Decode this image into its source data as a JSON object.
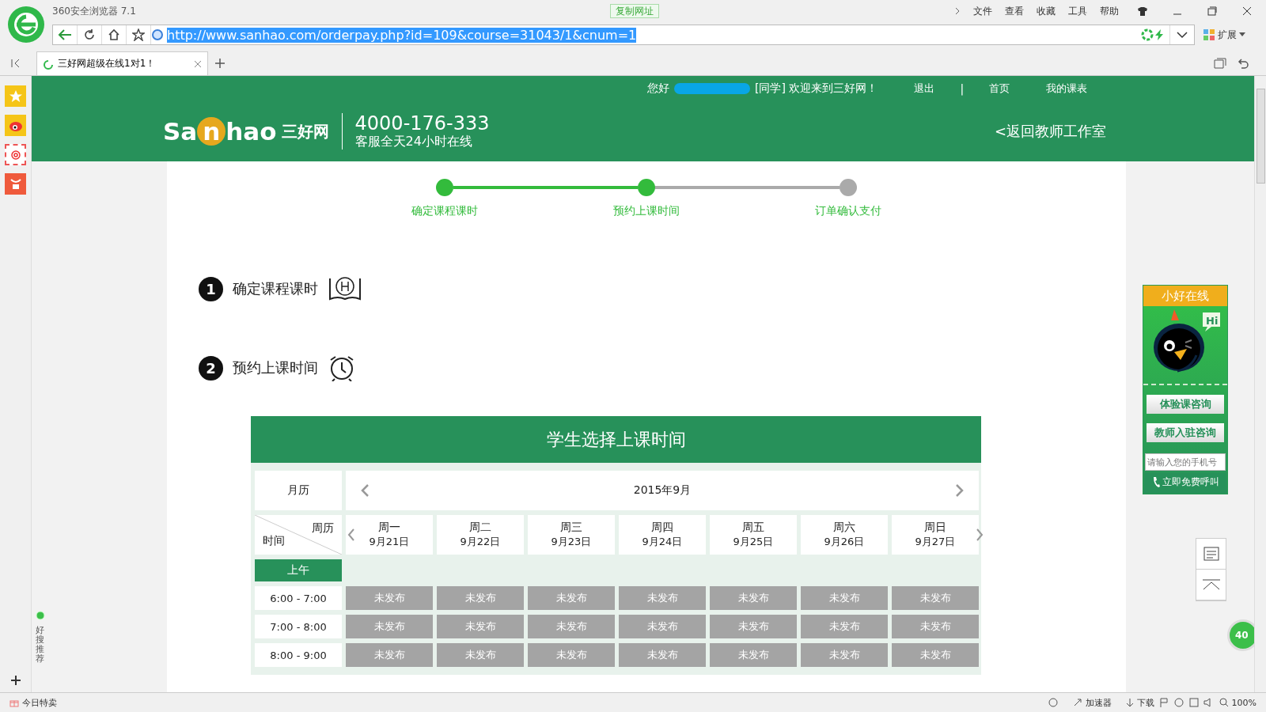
{
  "browser": {
    "title": "360安全浏览器 7.1",
    "copy_url": "复制网址",
    "menu": [
      "文件",
      "查看",
      "收藏",
      "工具",
      "帮助"
    ],
    "url": "http://www.sanhao.com/orderpay.php?id=109&course=31043/1&cnum=1",
    "extension": "扩展",
    "tab": {
      "title": "三好网超级在线1对1！",
      "selected": true
    },
    "side_recommend": "好搜推荐"
  },
  "header": {
    "greeting": "您好",
    "welcome": "[同学] 欢迎来到三好网！",
    "links": [
      "退出",
      "首页",
      "我的课表"
    ],
    "separator": "|",
    "logo": [
      "Sa",
      "n",
      "hao",
      "三好网"
    ],
    "phone": "4000-176-333",
    "service": "客服全天24小时在线",
    "back": "<返回教师工作室"
  },
  "steps": [
    {
      "label": "确定课程课时",
      "done": true
    },
    {
      "label": "预约上课时间",
      "done": true
    },
    {
      "label": "订单确认支付",
      "done": false
    }
  ],
  "sections": [
    {
      "number": "1",
      "title": "确定课程课时",
      "kind": "book"
    },
    {
      "number": "2",
      "title": "预约上课时间",
      "kind": "clock"
    }
  ],
  "calendar": {
    "title": "学生选择上课时间",
    "month_label": "月历",
    "month": "2015年9月",
    "corner_top": "周历",
    "corner_bottom": "时间",
    "period": "上午",
    "days": [
      {
        "weekday": "周一",
        "date": "9月21日"
      },
      {
        "weekday": "周二",
        "date": "9月22日"
      },
      {
        "weekday": "周三",
        "date": "9月23日"
      },
      {
        "weekday": "周四",
        "date": "9月24日"
      },
      {
        "weekday": "周五",
        "date": "9月25日"
      },
      {
        "weekday": "周六",
        "date": "9月26日"
      },
      {
        "weekday": "周日",
        "date": "9月27日"
      }
    ],
    "rows": [
      {
        "time": "6:00 - 7:00",
        "slots": [
          "未发布",
          "未发布",
          "未发布",
          "未发布",
          "未发布",
          "未发布",
          "未发布"
        ]
      },
      {
        "time": "7:00 - 8:00",
        "slots": [
          "未发布",
          "未发布",
          "未发布",
          "未发布",
          "未发布",
          "未发布",
          "未发布"
        ]
      },
      {
        "time": "8:00 - 9:00",
        "slots": [
          "未发布",
          "未发布",
          "未发布",
          "未发布",
          "未发布",
          "未发布",
          "未发布"
        ]
      }
    ]
  },
  "chat_widget": {
    "title": "小好在线",
    "hi": "Hi",
    "buttons": [
      "体验课咨询",
      "教师入驻咨询"
    ],
    "phone_placeholder": "请输入您的手机号",
    "call": "立即免费呼叫"
  },
  "floating_badge": "40",
  "status_bar": {
    "left": "今日特卖",
    "accelerator": "加速器",
    "download": "下载",
    "zoom": "100%"
  }
}
